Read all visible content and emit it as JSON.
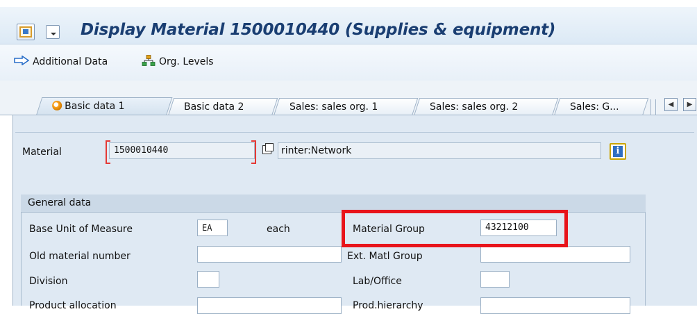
{
  "window": {
    "title": "Display Material 1500010440 (Supplies & equipment)"
  },
  "toolbar": {
    "additional_data": "Additional Data",
    "org_levels": "Org. Levels"
  },
  "tabs": [
    {
      "label": "Basic data 1",
      "active": true
    },
    {
      "label": "Basic data 2",
      "active": false
    },
    {
      "label": "Sales: sales org. 1",
      "active": false
    },
    {
      "label": "Sales: sales org. 2",
      "active": false
    },
    {
      "label": "Sales: G...",
      "active": false
    }
  ],
  "material": {
    "label": "Material",
    "number": "1500010440",
    "description": "rinter:Network"
  },
  "general_data": {
    "title": "General data",
    "base_uom_label": "Base Unit of Measure",
    "base_uom_value": "EA",
    "base_uom_text": "each",
    "material_group_label": "Material Group",
    "material_group_value": "43212100",
    "old_material_label": "Old material number",
    "old_material_value": "",
    "ext_matl_group_label": "Ext. Matl Group",
    "ext_matl_group_value": "",
    "division_label": "Division",
    "division_value": "",
    "lab_office_label": "Lab/Office",
    "lab_office_value": "",
    "product_allocation_label": "Product allocation",
    "prod_hierarchy_label": "Prod.hierarchy"
  },
  "colors": {
    "title": "#1a3e72",
    "highlight": "#e8141b",
    "required_bracket": "#e53935",
    "group_header": "#cbd9e7"
  }
}
